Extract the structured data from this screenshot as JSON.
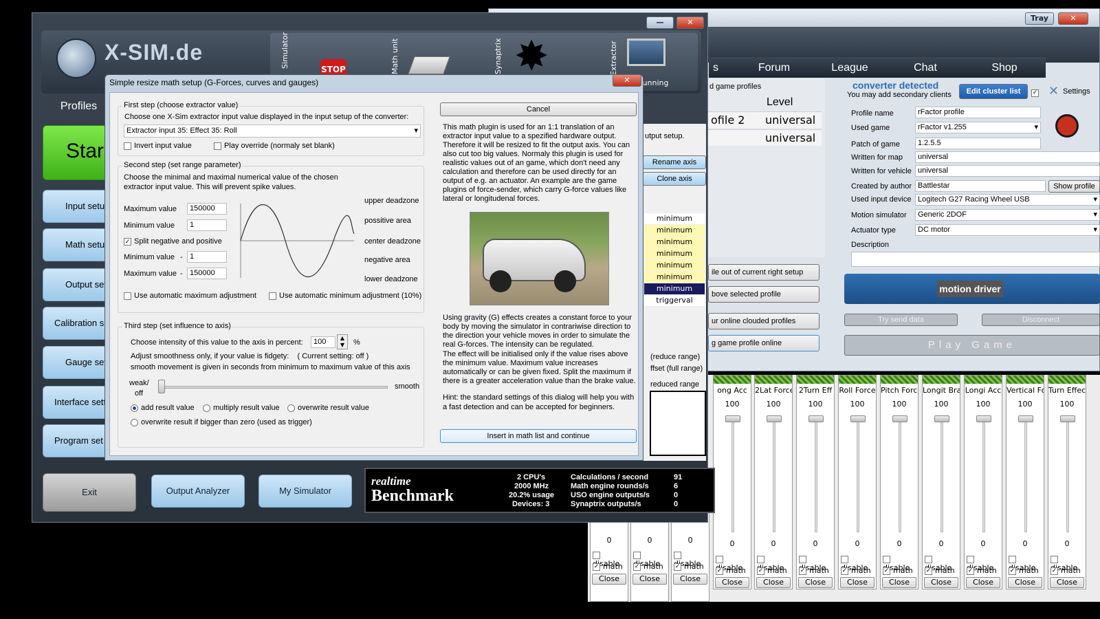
{
  "right_window": {
    "tray_label": "Tray",
    "close_label": "✕",
    "nav": [
      "Forum",
      "League",
      "Chat",
      "Shop"
    ],
    "nav_partial": "s",
    "profiles_header": "d game profiles",
    "level_header": "Level",
    "profile_rows": [
      {
        "name": "ofile 2",
        "level": "universal"
      },
      {
        "name": "",
        "level": "universal"
      }
    ],
    "converter_status": "converter detected",
    "converter_sub": "You may add secondary clients",
    "edit_cluster": "Edit cluster list",
    "settings_label": "Settings",
    "fields": [
      {
        "label": "Profile name",
        "value": "rFactor profile"
      },
      {
        "label": "Used game",
        "value": "rFactor v1.255"
      },
      {
        "label": "Patch of game",
        "value": "1.2.5.5"
      },
      {
        "label": "Written for map",
        "value": "universal"
      },
      {
        "label": "Written for vehicle",
        "value": "universal"
      },
      {
        "label": "Created by author",
        "value": "Battlestar"
      },
      {
        "label": "Used input device",
        "value": "Logitech G27 Racing Wheel USB"
      },
      {
        "label": "Motion simulator",
        "value": "Generic 2DOF"
      },
      {
        "label": "Actuator type",
        "value": "DC motor"
      },
      {
        "label": "Description",
        "value": ""
      }
    ],
    "show_profile": "Show profile",
    "motion_driver_logo": "motion driver",
    "try_send": "Try send data",
    "disconnect": "Disconnect",
    "play_game": "Play Game",
    "profile_actions": [
      "ile out of current right setup",
      "bove selected profile",
      "ur online clouded profiles",
      "g game profile online"
    ]
  },
  "main_window": {
    "logo_text": "X-SIM.de",
    "header_icons": [
      {
        "label": "Simulator",
        "icon": "stop-sign-icon"
      },
      {
        "label": "Math unit",
        "icon": "cpu-chip-icon"
      },
      {
        "label": "Synaptrix",
        "icon": "burst-icon"
      },
      {
        "label": "Extractor",
        "icon": "computer-icon"
      }
    ],
    "running_label": "running",
    "profiles_tab": "Profiles",
    "start_label": "Star",
    "left_buttons": [
      "Input setu",
      "Math setu",
      "Output set",
      "Calibration s",
      "Gauge set",
      "Interface sett",
      "Program set"
    ],
    "exit": "Exit",
    "output_analyzer": "Output Analyzer",
    "my_simulator": "My Simulator",
    "output_setup_partial": "utput setup.",
    "rename_axis": "Rename axis",
    "clone_axis": "Clone axis",
    "axis_rows": [
      "minimum",
      "minimum",
      "minimum",
      "minimum",
      "minimum",
      "minimum",
      "minimum",
      "triggerval"
    ],
    "range_labels": [
      "(reduce range)",
      "ffset (full range)",
      "reduced range"
    ],
    "benchmark": {
      "logo_line1": "realtime",
      "logo_line2": "Benchmark",
      "stats_left": [
        "2 CPU's",
        "2000 MHz",
        "20.2% usage",
        "Devices: 3"
      ],
      "stats_mid": [
        "Calculations / second",
        "Math engine rounds/s",
        "USO engine outputs/s",
        "Synaptrix outputs/s"
      ],
      "stats_right": [
        "91",
        "6",
        "0",
        "0"
      ]
    }
  },
  "dialog": {
    "title": "Simple resize math setup (G-Forces, curves and gauges)",
    "close": "✕",
    "step1_title": "First step (choose extractor value)",
    "step1_desc": "Choose one X-Sim extractor input value displayed in the input setup of the converter:",
    "extractor_value": "Extractor input 35: Effect 35: Roll",
    "invert_label": "Invert input value",
    "play_override_label": "Play override (normaly set blank)",
    "step2_title": "Second step (set range parameter)",
    "step2_desc1": "Choose the minimal and maximal numerical value of the chosen",
    "step2_desc2": "extractor input value. This will prevent spike values.",
    "max_label": "Maximum value",
    "max_value": "150000",
    "min_label": "Minimum value",
    "min_value": "1",
    "split_label": "Split negative and positive",
    "neg_min_label": "Minimum value",
    "neg_min_value": "1",
    "neg_max_label": "Maximum value",
    "neg_max_value": "150000",
    "minus": "-",
    "zones": [
      "upper deadzone",
      "possitive area",
      "center deadzone",
      "negative area",
      "lower deadzone"
    ],
    "auto_max": "Use automatic maximum adjustment",
    "auto_min": "Use automatic minimum adjustment (10%)",
    "step3_title": "Third step (set influence to axis)",
    "intensity_label": "Choose intensity of this value to the axis in percent:",
    "intensity_value": "100",
    "percent": "%",
    "smooth_line1": "Adjust smoothness only, if your value is fidgety:    ( Current setting: off )",
    "smooth_line2": "smooth movement is given in seconds from minimum to maximum value of this axis",
    "weak_label": "weak/",
    "off_label": "off",
    "smooth_label": "smooth",
    "radio_add": "add result value",
    "radio_multiply": "multiply result value",
    "radio_overwrite": "overwrite result value",
    "radio_trigger": "overwrite result if bigger than zero (used as trigger)",
    "cancel": "Cancel",
    "info1": "This math plugin is used for an 1:1 translation of an extractor input value to a spezified hardware output. Therefore it will be resized to fit the output axis. You can also cut too big values. Normaly this plugin is used for realistic values out of an game, which don't need any calculation and therefore can be used directly for an output of e.g. an actuator. An example are the game plugins of force-sender, which carry G-force values like lateral or longitudenal forces.",
    "info2": "Using gravity (G) effects creates a constant force to your body by moving the simulator in contrariwise direction to the direction your vehicle moves in order to simulate the real G-forces. The intensity can be regulated.",
    "info3": "The effect will be initialised only if the value rises above the minimum value. Maximum value increases automatically or can be given fixed. Split the maximum if there is a greater acceleration value than the brake value.",
    "hint": "Hint: the standard settings of this dialog will help you with a fast detection and can be accepted for beginners.",
    "insert": "Insert in math list and continue"
  },
  "sliders": {
    "partial_cols": [
      {
        "bottom": "0"
      },
      {
        "bottom": "0"
      },
      {
        "bottom": "0"
      }
    ],
    "cols": [
      {
        "name": "ong Acc",
        "top": "100",
        "bottom": "0"
      },
      {
        "name": "2Lat Force",
        "top": "100",
        "bottom": "0"
      },
      {
        "name": "2Turn Eff",
        "top": "100",
        "bottom": "0"
      },
      {
        "name": "Roll Force",
        "top": "100",
        "bottom": "0"
      },
      {
        "name": "Pitch Force",
        "top": "100",
        "bottom": "0"
      },
      {
        "name": "Longit Brak",
        "top": "100",
        "bottom": "0"
      },
      {
        "name": "Longi Acc",
        "top": "100",
        "bottom": "0"
      },
      {
        "name": "Vertical Forc",
        "top": "100",
        "bottom": "0"
      },
      {
        "name": "Turn Effect",
        "top": "100",
        "bottom": "0"
      }
    ],
    "disable": "disable",
    "math": "math",
    "close": "Close"
  },
  "colors": {
    "accent": "#1e62b0",
    "start_green": "#5ed430",
    "dark_panel": "#3b4552"
  }
}
